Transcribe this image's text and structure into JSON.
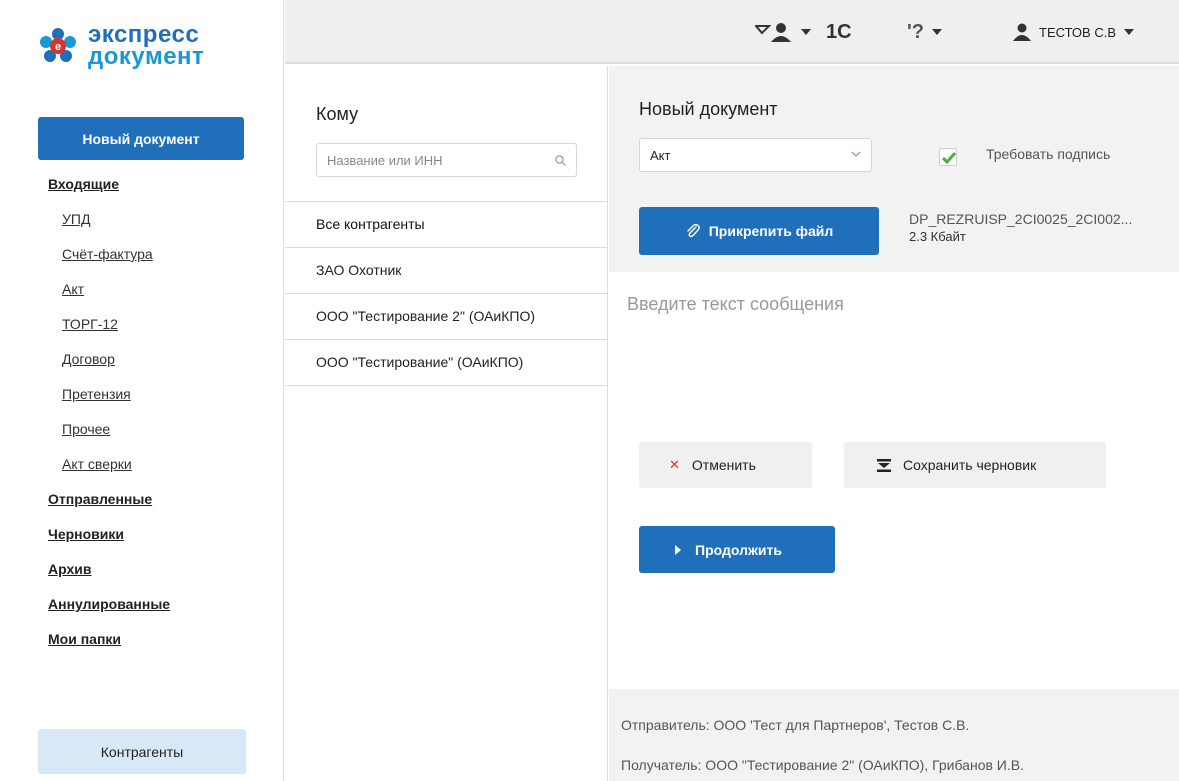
{
  "brand": {
    "line1": "экспресс",
    "line2": "документ"
  },
  "sidebar": {
    "new_doc_label": "Новый документ",
    "incoming": "Входящие",
    "incoming_items": [
      "УПД",
      "Счёт-фактура",
      "Акт",
      "ТОРГ-12",
      "Договор",
      "Претензия",
      "Прочее",
      "Акт сверки"
    ],
    "sent": "Отправленные",
    "drafts": "Черновики",
    "archive": "Архив",
    "cancelled": "Аннулированные",
    "my_folders": "Мои папки",
    "contractors_label": "Контрагенты"
  },
  "topbar": {
    "one_c": "1С",
    "help": "'?",
    "user": "ТЕСТОВ С.В",
    "icons": [
      "messages-icon",
      "user-icon"
    ]
  },
  "to_column": {
    "title": "Кому",
    "search_placeholder": "Название или ИНН",
    "contractors": [
      "Все контрагенты",
      "ЗАО Охотник",
      "ООО \"Тестирование 2\" (ОАиКПО)",
      "ООО \"Тестирование\" (ОАиКПО)"
    ]
  },
  "doc": {
    "title": "Новый документ",
    "type_value": "Акт",
    "require_signature_label": "Требовать подпись",
    "require_signature_checked": true,
    "attach_label": "Прикрепить файл",
    "file_name": "DP_REZRUISP_2CI0025_2CI002...",
    "file_size": "2.3 Кбайт",
    "message_placeholder": "Введите текст сообщения",
    "cancel_label": "Отменить",
    "save_draft_label": "Сохранить черновик",
    "continue_label": "Продолжить",
    "sender": "Отправитель: ООО 'Тест для Партнеров', Тестов С.В.",
    "recipient": "Получатель: ООО \"Тестирование 2\" (ОАиКПО), Грибанов И.В."
  },
  "colors": {
    "primary": "#1f6fba",
    "brand_light": "#1a98d5",
    "check": "#4caf3a",
    "cancel_x": "#d9342b",
    "panel_gray": "#f2f2f2",
    "contractors_btn": "#d9e8f6"
  }
}
